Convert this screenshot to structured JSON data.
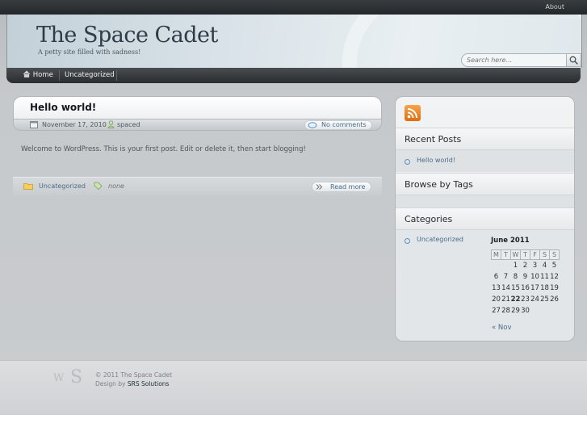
{
  "topbar": {
    "about": "About"
  },
  "header": {
    "site_title": "The Space Cadet",
    "tagline": "A petty site filled with sadness!",
    "search_placeholder": "Search here..."
  },
  "nav": {
    "items": [
      "Home",
      "Uncategorized"
    ]
  },
  "post": {
    "title": "Hello world!",
    "date": "November 17, 2010",
    "author": "spaced",
    "comments": "No comments",
    "body": "Welcome to WordPress. This is your first post. Edit or delete it, then start blogging!",
    "category": "Uncategorized",
    "tags": "none",
    "read_more": "Read more"
  },
  "sidebar": {
    "recent_posts_heading": "Recent Posts",
    "recent_posts": [
      "Hello world!"
    ],
    "tags_heading": "Browse by Tags",
    "categories_heading": "Categories",
    "categories": [
      "Uncategorized"
    ],
    "calendar": {
      "title": "June 2011",
      "weekdays": [
        "M",
        "T",
        "W",
        "T",
        "F",
        "S",
        "S"
      ],
      "weeks": [
        [
          "",
          "",
          "1",
          "2",
          "3",
          "4",
          "5"
        ],
        [
          "6",
          "7",
          "8",
          "9",
          "10",
          "11",
          "12"
        ],
        [
          "13",
          "14",
          "15",
          "16",
          "17",
          "18",
          "19"
        ],
        [
          "20",
          "21",
          "22",
          "23",
          "24",
          "25",
          "26"
        ],
        [
          "27",
          "28",
          "29",
          "30",
          "",
          "",
          ""
        ]
      ],
      "today": "22",
      "prev": "« Nov"
    }
  },
  "footer": {
    "copyright": "© 2011 The Space Cadet",
    "design_by": "Design by",
    "designer": "SRS Solutions",
    "logo_w": "W",
    "logo_s": "S"
  },
  "colors": {
    "link": "#4a6b8a",
    "rss": "#e8801e",
    "nav_bg": "#2a2d30"
  },
  "icons": [
    "home-icon",
    "search-icon",
    "calendar-icon",
    "user-icon",
    "comment-icon",
    "folder-icon",
    "tag-icon",
    "read-more-icon",
    "rss-icon",
    "wordpress-logo-icon",
    "srs-logo-icon"
  ]
}
